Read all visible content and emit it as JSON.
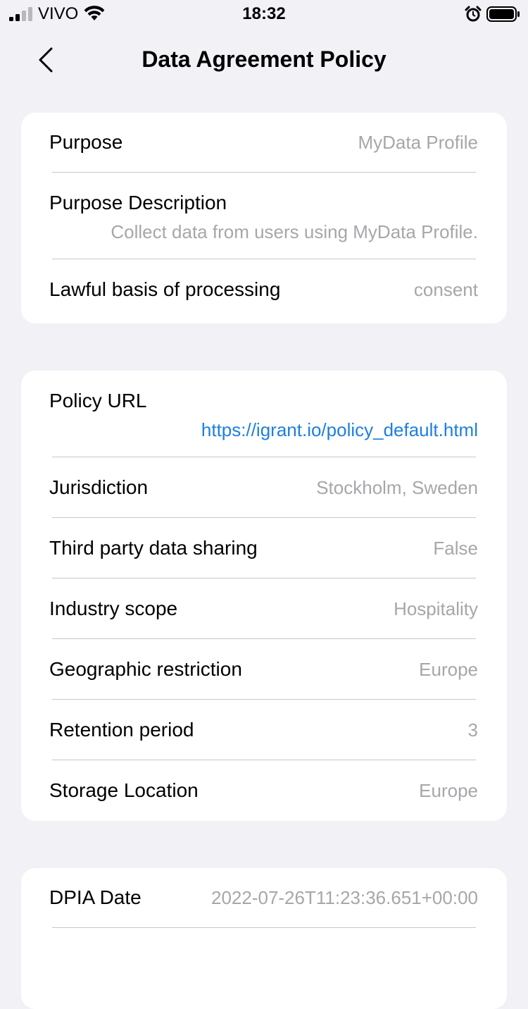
{
  "status_bar": {
    "carrier": "VIVO",
    "time": "18:32"
  },
  "nav": {
    "title": "Data Agreement Policy"
  },
  "sections": [
    {
      "rows": [
        {
          "label": "Purpose",
          "value": "MyData Profile"
        },
        {
          "label": "Purpose Description",
          "value": "Collect data from users using MyData Profile."
        },
        {
          "label": "Lawful basis of processing",
          "value": "consent"
        }
      ]
    },
    {
      "rows": [
        {
          "label": "Policy URL",
          "value": "https://igrant.io/policy_default.html"
        },
        {
          "label": "Jurisdiction",
          "value": "Stockholm, Sweden"
        },
        {
          "label": "Third party data sharing",
          "value": "False"
        },
        {
          "label": "Industry scope",
          "value": "Hospitality"
        },
        {
          "label": "Geographic restriction",
          "value": "Europe"
        },
        {
          "label": "Retention period",
          "value": "3"
        },
        {
          "label": "Storage Location",
          "value": "Europe"
        }
      ]
    },
    {
      "rows": [
        {
          "label": "DPIA Date",
          "value": "2022-07-26T11:23:36.651+00:00"
        }
      ]
    }
  ],
  "colors": {
    "background": "#f1f1f6",
    "card": "#ffffff",
    "label": "#000000",
    "value": "#a7a7ab",
    "link": "#1d7fe0",
    "separator": "#c8c7cc"
  },
  "icons": {
    "signal": "cellular-signal-icon",
    "wifi": "wifi-icon",
    "alarm": "alarm-clock-icon",
    "battery": "battery-icon",
    "back": "chevron-left-icon"
  }
}
